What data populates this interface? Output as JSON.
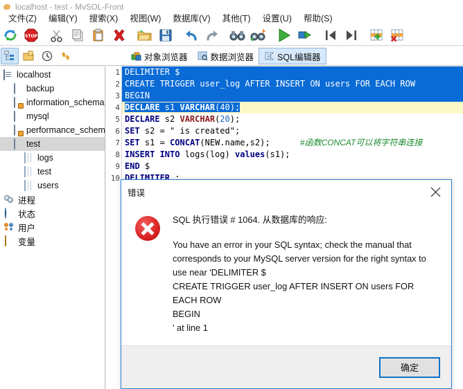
{
  "window": {
    "title": "localhost - test - MySQL-Front",
    "app_icon": "mysql-dolphin-icon"
  },
  "menubar": {
    "items": [
      {
        "label": "文件(Z)",
        "name": "menu-file"
      },
      {
        "label": "编辑(Y)",
        "name": "menu-edit"
      },
      {
        "label": "搜索(X)",
        "name": "menu-search"
      },
      {
        "label": "视图(W)",
        "name": "menu-view"
      },
      {
        "label": "数据库(V)",
        "name": "menu-database"
      },
      {
        "label": "其他(T)",
        "name": "menu-other"
      },
      {
        "label": "设置(U)",
        "name": "menu-settings"
      },
      {
        "label": "帮助(S)",
        "name": "menu-help"
      }
    ]
  },
  "toolbar_main": {
    "buttons": [
      {
        "icon": "refresh-icon"
      },
      {
        "icon": "stop-icon"
      },
      {
        "icon": "cut-icon"
      },
      {
        "icon": "copy-icon"
      },
      {
        "icon": "paste-icon"
      },
      {
        "icon": "delete-icon"
      },
      {
        "icon": "open-folder-icon"
      },
      {
        "icon": "save-icon"
      },
      {
        "icon": "undo-icon"
      },
      {
        "icon": "redo-icon"
      },
      {
        "icon": "find-icon"
      },
      {
        "icon": "find-replace-icon"
      },
      {
        "icon": "run-icon"
      },
      {
        "icon": "run-step-icon"
      },
      {
        "icon": "first-record-icon"
      },
      {
        "icon": "last-record-icon"
      },
      {
        "icon": "add-row-icon"
      },
      {
        "icon": "delete-row-icon"
      }
    ]
  },
  "toolbar_secondary": {
    "buttons": [
      {
        "icon": "tree-view-icon",
        "active": true
      },
      {
        "icon": "objects-icon",
        "active": false
      },
      {
        "icon": "history-icon",
        "active": false
      },
      {
        "icon": "footsteps-icon",
        "active": false
      }
    ]
  },
  "tabs": [
    {
      "label": "对象浏览器",
      "icon": "objects-browser-icon",
      "active": false,
      "name": "tab-object-browser"
    },
    {
      "label": "数据浏览器",
      "icon": "data-browser-icon",
      "active": false,
      "name": "tab-data-browser"
    },
    {
      "label": "SQL编辑器",
      "icon": "sql-editor-icon",
      "active": true,
      "name": "tab-sql-editor"
    }
  ],
  "sidebar": {
    "items": [
      {
        "label": "localhost",
        "icon": "server-icon",
        "indent": 0,
        "selected": false
      },
      {
        "label": "backup",
        "icon": "database-icon",
        "indent": 1,
        "selected": false
      },
      {
        "label": "information_schema",
        "icon": "system-database-icon",
        "indent": 1,
        "selected": false
      },
      {
        "label": "mysql",
        "icon": "database-icon",
        "indent": 1,
        "selected": false
      },
      {
        "label": "performance_schema",
        "icon": "system-database-icon",
        "indent": 1,
        "selected": false
      },
      {
        "label": "test",
        "icon": "database-icon",
        "indent": 1,
        "selected": true
      },
      {
        "label": "logs",
        "icon": "table-icon",
        "indent": 2,
        "selected": false
      },
      {
        "label": "test",
        "icon": "table-icon",
        "indent": 2,
        "selected": false
      },
      {
        "label": "users",
        "icon": "table-icon",
        "indent": 2,
        "selected": false
      },
      {
        "label": "进程",
        "icon": "process-icon",
        "indent": 0,
        "selected": false
      },
      {
        "label": "状态",
        "icon": "status-globe-icon",
        "indent": 0,
        "selected": false
      },
      {
        "label": "用户",
        "icon": "users-icon",
        "indent": 0,
        "selected": false
      },
      {
        "label": "变量",
        "icon": "variable-icon",
        "indent": 0,
        "selected": false
      }
    ]
  },
  "editor": {
    "lines": [
      {
        "n": "1",
        "text": "DELIMITER $",
        "selected": true
      },
      {
        "n": "2",
        "text": "CREATE TRIGGER user_log AFTER INSERT ON users FOR EACH ROW",
        "selected": true
      },
      {
        "n": "3",
        "text": "BEGIN",
        "selected": true
      },
      {
        "n": "4",
        "text": "DECLARE s1 VARCHAR(40);",
        "selected": true,
        "current": true
      },
      {
        "n": "5",
        "text": "DECLARE s2 VARCHAR(20);",
        "selected": false
      },
      {
        "n": "6",
        "text": "SET s2 = \" is created\";",
        "selected": false
      },
      {
        "n": "7",
        "text": "SET s1 = CONCAT(NEW.name,s2);",
        "selected": false,
        "comment": "#函数CONCAT可以将字符串连接"
      },
      {
        "n": "8",
        "text": "INSERT INTO logs(log) values(s1);",
        "selected": false
      },
      {
        "n": "9",
        "text": "END $",
        "selected": false
      },
      {
        "n": "10",
        "text": "DELIMITER ;",
        "selected": false
      }
    ],
    "selection_color": "#0a6bd6",
    "current_line_color": "#fbf9c8",
    "comment_color": "#1a8a2e"
  },
  "dialog": {
    "title": "错误",
    "close_icon": "close-icon",
    "error_icon": "error-circle-icon",
    "headline": "SQL 执行错误 # 1064. 从数据库的响应:",
    "message": "You have an error in your SQL syntax; check the manual that corresponds to your MySQL server version for the right syntax to use near 'DELIMITER $\nCREATE TRIGGER user_log AFTER INSERT ON users FOR EACH ROW\nBEGIN\n' at line 1",
    "ok_label": "确定",
    "accent_color": "#1072c6",
    "error_color": "#d81f1f"
  }
}
